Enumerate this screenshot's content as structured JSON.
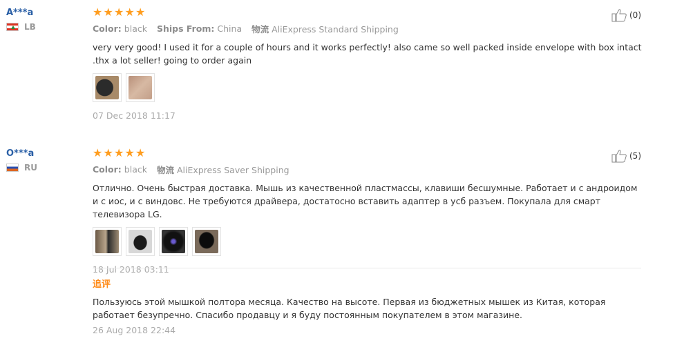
{
  "reviews": [
    {
      "user_name": "A***a",
      "country": "LB",
      "rating": 5,
      "color_label": "Color:",
      "color_value": "black",
      "ships_label": "Ships From:",
      "ships_value": "China",
      "logistics_label": "物流",
      "logistics_value": "AliExpress Standard Shipping",
      "text": "very very good! I used it for a couple of hours and it works perfectly! also came so well packed inside envelope with box intact .thx a lot seller! going to order again",
      "thumbnails": [
        "photo-1",
        "photo-2"
      ],
      "date": "07 Dec 2018 11:17",
      "helpful_count": "(0)"
    },
    {
      "user_name": "O***a",
      "country": "RU",
      "rating": 5,
      "color_label": "Color:",
      "color_value": "black",
      "logistics_label": "物流",
      "logistics_value": "AliExpress Saver Shipping",
      "text": "Отлично. Очень быстрая доставка. Мышь из качественной пластмассы, клавиши бесшумные. Работает и с андроидом и с иос, и с виндовс. Не требуются драйвера, достатосно вставить адаптер в усб разъем. Покупала для смарт телевизора LG.",
      "thumbnails": [
        "photo-1",
        "photo-2",
        "photo-3",
        "photo-4"
      ],
      "date": "18 Jul 2018 03:11",
      "helpful_count": "(5)",
      "additional": {
        "label": "追评",
        "text": "Пользуюсь этой мышкой полтора месяца. Качество на высоте. Первая из бюджетных мышек из Китая, которая работает безупречно. Спасибо продавцу и я буду постоянным покупателем в этом магазине.",
        "date": "26 Aug 2018 22:44"
      }
    }
  ],
  "icons": {
    "star": "star-icon",
    "helpful": "thumbs-up-icon"
  },
  "colors": {
    "star": "#ff9d1f",
    "user_name": "#2a5fa6",
    "additional_label": "#ff8c1a"
  }
}
